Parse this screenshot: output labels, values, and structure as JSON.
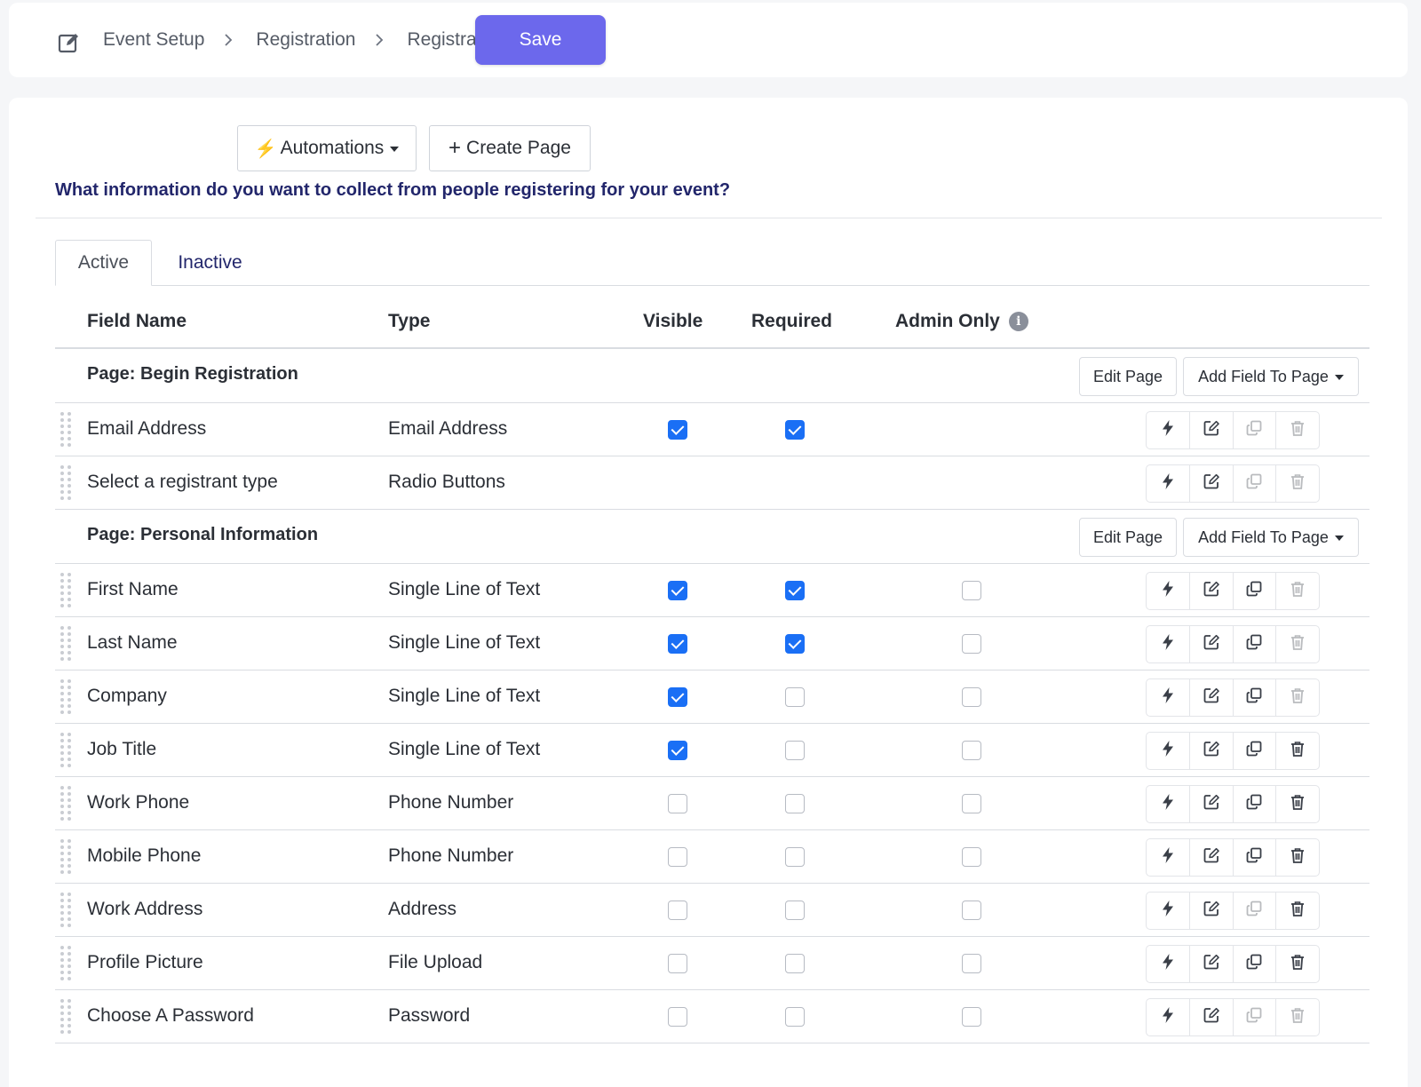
{
  "breadcrumb": {
    "items": [
      "Event Setup",
      "Registration",
      "Registra"
    ]
  },
  "toolbar": {
    "save_label": "Save",
    "automations_label": "Automations",
    "create_page_label": "Create Page"
  },
  "question": "What information do you want to collect from people registering for your event?",
  "tabs": [
    {
      "label": "Active",
      "active": true
    },
    {
      "label": "Inactive",
      "active": false
    }
  ],
  "columns": {
    "field_name": "Field Name",
    "type": "Type",
    "visible": "Visible",
    "required": "Required",
    "admin_only": "Admin Only"
  },
  "page_buttons": {
    "edit_page": "Edit Page",
    "add_field": "Add Field To Page"
  },
  "pages": [
    {
      "title": "Page: Begin Registration",
      "fields": [
        {
          "name": "Email Address",
          "type": "Email Address",
          "visible": true,
          "required": true,
          "admin_only": null,
          "copy_enabled": false,
          "delete_enabled": false
        },
        {
          "name": "Select a registrant type",
          "type": "Radio Buttons",
          "visible": null,
          "required": null,
          "admin_only": null,
          "copy_enabled": false,
          "delete_enabled": false
        }
      ]
    },
    {
      "title": "Page: Personal Information",
      "fields": [
        {
          "name": "First Name",
          "type": "Single Line of Text",
          "visible": true,
          "required": true,
          "admin_only": false,
          "copy_enabled": true,
          "delete_enabled": false
        },
        {
          "name": "Last Name",
          "type": "Single Line of Text",
          "visible": true,
          "required": true,
          "admin_only": false,
          "copy_enabled": true,
          "delete_enabled": false
        },
        {
          "name": "Company",
          "type": "Single Line of Text",
          "visible": true,
          "required": false,
          "admin_only": false,
          "copy_enabled": true,
          "delete_enabled": false
        },
        {
          "name": "Job Title",
          "type": "Single Line of Text",
          "visible": true,
          "required": false,
          "admin_only": false,
          "copy_enabled": true,
          "delete_enabled": true
        },
        {
          "name": "Work Phone",
          "type": "Phone Number",
          "visible": false,
          "required": false,
          "admin_only": false,
          "copy_enabled": true,
          "delete_enabled": true
        },
        {
          "name": "Mobile Phone",
          "type": "Phone Number",
          "visible": false,
          "required": false,
          "admin_only": false,
          "copy_enabled": true,
          "delete_enabled": true
        },
        {
          "name": "Work Address",
          "type": "Address",
          "visible": false,
          "required": false,
          "admin_only": false,
          "copy_enabled": false,
          "delete_enabled": true
        },
        {
          "name": "Profile Picture",
          "type": "File Upload",
          "visible": false,
          "required": false,
          "admin_only": false,
          "copy_enabled": true,
          "delete_enabled": true
        },
        {
          "name": "Choose A Password",
          "type": "Password",
          "visible": false,
          "required": false,
          "admin_only": false,
          "copy_enabled": false,
          "delete_enabled": false
        }
      ]
    }
  ],
  "colors": {
    "accent": "#6c68ec",
    "checkbox": "#1a6ff5",
    "heading": "#22266b",
    "bolt": "#f2a41a"
  },
  "icons": {
    "action_buttons": [
      "lightning-icon",
      "edit-icon",
      "copy-icon",
      "trash-icon"
    ]
  }
}
